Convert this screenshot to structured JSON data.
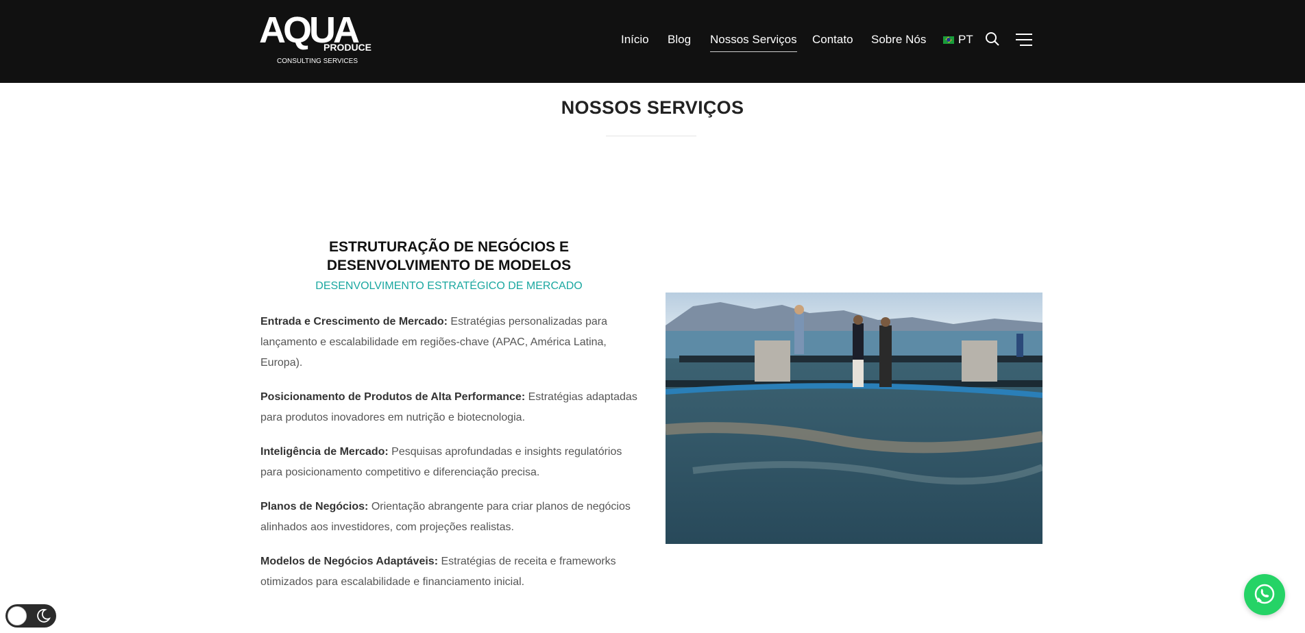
{
  "header": {
    "logo": {
      "main": "AQUA",
      "sub1": "PRODUCE",
      "sub2": "CONSULTING SERVICES"
    },
    "nav": [
      {
        "label": "Início"
      },
      {
        "label": "Blog"
      },
      {
        "label": "Nossos Serviços",
        "active": true
      },
      {
        "label": "Contato"
      },
      {
        "label": "Sobre Nós"
      }
    ],
    "language": "PT",
    "icons": [
      "brazil-flag-icon",
      "search-icon",
      "menu-icon"
    ]
  },
  "main": {
    "page_title": "NOSSOS SERVIÇOS",
    "section_title": "ESTRUTURAÇÃO DE NEGÓCIOS E DESENVOLVIMENTO DE MODELOS",
    "section_subtitle": "DESENVOLVIMENTO ESTRATÉGICO DE MERCADO",
    "items": [
      {
        "heading": "Entrada e Crescimento de Mercado:",
        "text": " Estratégias personalizadas para lançamento e escalabilidade em regiões-chave (APAC, América Latina, Europa)."
      },
      {
        "heading": "Posicionamento de Produtos de Alta Performance:",
        "text": " Estratégias adaptadas para produtos inovadores em nutrição e biotecnologia."
      },
      {
        "heading": "Inteligência de Mercado:",
        "text": " Pesquisas aprofundadas e insights regulatórios para posicionamento competitivo e diferenciação precisa."
      },
      {
        "heading": "Planos de Negócios:",
        "text": " Orientação abrangente para criar planos de negócios alinhados aos investidores, com projeções realistas."
      },
      {
        "heading": "Modelos de Negócios Adaptáveis:",
        "text": " Estratégias de receita e frameworks otimizados para escalabilidade e financiamento inicial."
      }
    ]
  },
  "widgets": {
    "dark_mode_toggle": {
      "icons": [
        "sun-icon",
        "moon-icon"
      ]
    },
    "whatsapp": {
      "icon": "whatsapp-icon"
    }
  },
  "colors": {
    "header_bg": "#111111",
    "accent": "#1aa7a0",
    "whatsapp": "#25d366"
  }
}
